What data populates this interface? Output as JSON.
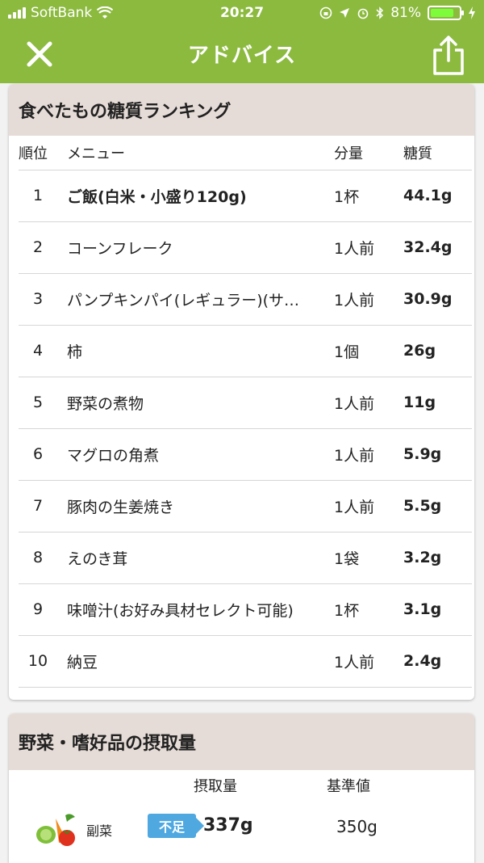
{
  "status": {
    "carrier": "SoftBank",
    "time": "20:27",
    "battery": "81%",
    "battery_level": 0.81
  },
  "nav": {
    "title": "アドバイス"
  },
  "ranking": {
    "title": "食べたもの糖質ランキング",
    "headers": {
      "rank": "順位",
      "menu": "メニュー",
      "qty": "分量",
      "carb": "糖質"
    },
    "rows": [
      {
        "rank": "1",
        "menu": "ご飯(白米・小盛り120g)",
        "qty": "1杯",
        "carb": "44.1g"
      },
      {
        "rank": "2",
        "menu": "コーンフレーク",
        "qty": "1人前",
        "carb": "32.4g"
      },
      {
        "rank": "3",
        "menu": "パンプキンパイ(レギュラー)(サ…",
        "qty": "1人前",
        "carb": "30.9g"
      },
      {
        "rank": "4",
        "menu": "柿",
        "qty": "1個",
        "carb": "26g"
      },
      {
        "rank": "5",
        "menu": "野菜の煮物",
        "qty": "1人前",
        "carb": "11g"
      },
      {
        "rank": "6",
        "menu": "マグロの角煮",
        "qty": "1人前",
        "carb": "5.9g"
      },
      {
        "rank": "7",
        "menu": "豚肉の生姜焼き",
        "qty": "1人前",
        "carb": "5.5g"
      },
      {
        "rank": "8",
        "menu": "えのき茸",
        "qty": "1袋",
        "carb": "3.2g"
      },
      {
        "rank": "9",
        "menu": "味噌汁(お好み具材セレクト可能)",
        "qty": "1杯",
        "carb": "3.1g"
      },
      {
        "rank": "10",
        "menu": "納豆",
        "qty": "1人前",
        "carb": "2.4g"
      }
    ]
  },
  "intake": {
    "title": "野菜・嗜好品の摂取量",
    "headers": {
      "amount": "摂取量",
      "standard": "基準値"
    },
    "rows": [
      {
        "label": "副菜",
        "badge": "不足",
        "amount": "337g",
        "standard": "350g"
      }
    ]
  },
  "colors": {
    "header": "#8cba3f",
    "card_title_bg": "#e6dcd7",
    "badge": "#4fa8e0"
  }
}
